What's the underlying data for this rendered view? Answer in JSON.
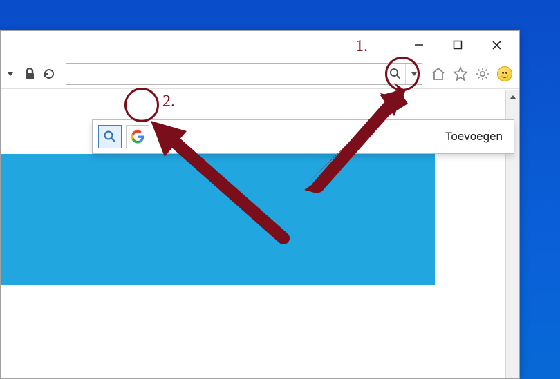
{
  "annotations": {
    "label1": "1.",
    "label2": "2."
  },
  "search": {
    "value": "",
    "placeholder": ""
  },
  "dropdown": {
    "add_label": "Toevoegen",
    "engines": [
      {
        "name": "default-search",
        "selected": true
      },
      {
        "name": "google",
        "selected": false
      }
    ]
  },
  "icons": {
    "minimize": "minimize-icon",
    "maximize": "maximize-icon",
    "close": "close-icon",
    "dropdown_caret": "caret-down-icon",
    "lock": "lock-icon",
    "refresh": "refresh-icon",
    "search": "search-icon",
    "home": "home-icon",
    "star": "star-icon",
    "gear": "gear-icon",
    "smiley": "smiley-icon",
    "scroll_up": "scroll-up-icon"
  },
  "colors": {
    "desktop": "#0a5fd8",
    "content_block": "#22a6e0",
    "annotation": "#7a0e1a"
  }
}
